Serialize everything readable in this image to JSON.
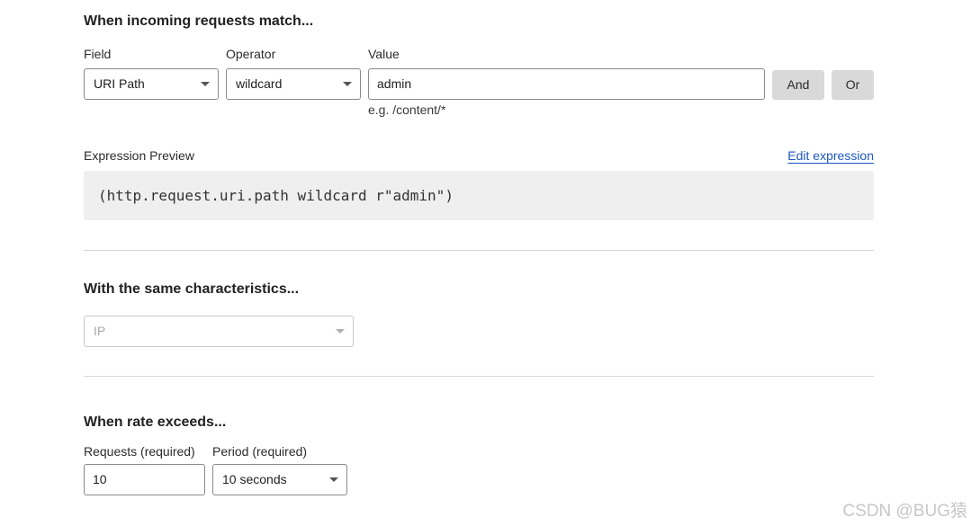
{
  "match_section": {
    "title": "When incoming requests match...",
    "field_label": "Field",
    "operator_label": "Operator",
    "value_label": "Value",
    "field_value": "URI Path",
    "operator_value": "wildcard",
    "value_value": "admin",
    "value_hint": "e.g. /content/*",
    "and_button": "And",
    "or_button": "Or"
  },
  "expression": {
    "label": "Expression Preview",
    "edit_link": "Edit expression",
    "code": "(http.request.uri.path wildcard r\"admin\")"
  },
  "characteristics_section": {
    "title": "With the same characteristics...",
    "select_value": "IP"
  },
  "rate_section": {
    "title": "When rate exceeds...",
    "requests_label": "Requests (required)",
    "period_label": "Period (required)",
    "requests_value": "10",
    "period_value": "10 seconds"
  },
  "watermark": "CSDN @BUG猿"
}
